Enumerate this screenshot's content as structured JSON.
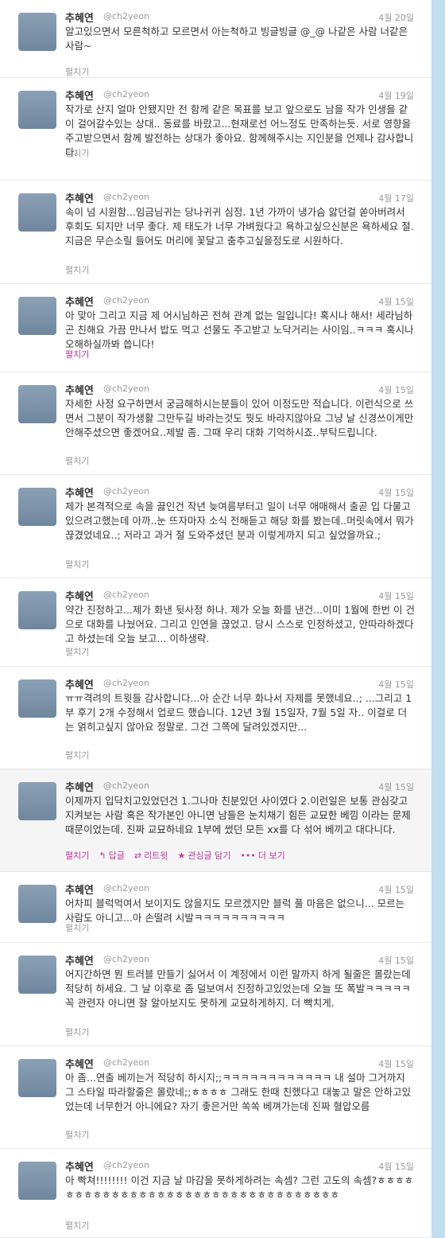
{
  "user": {
    "name": "추혜연",
    "handle": "@ch2yeon"
  },
  "expand_label": "펼치기",
  "actions": [
    {
      "icon": "reply-icon",
      "glyph": "↰",
      "label": "답글"
    },
    {
      "icon": "retweet-icon",
      "glyph": "⇄",
      "label": "리트윗"
    },
    {
      "icon": "favorite-star-icon",
      "glyph": "★",
      "label": "관심글 담기"
    },
    {
      "icon": "more-dots-icon",
      "glyph": "•••",
      "label": "더 보기"
    }
  ],
  "tweets": [
    {
      "date": "4월 20일",
      "text": "알고있으면서 모른척하고 모르면서 아는척하고 빙글빙글 @_@ 나같은 사람 너같은사람~"
    },
    {
      "date": "4월 19일",
      "text": "작가로 산지 얼마 안됐지만 전 함께 같은 목표를 보고 앞으로도 남을 작가 인생을 같이 걸어갈수있는 상대.. 동료를 바랐고...현재로선 어느정도 만족하는듯. 서로 영향을 주고받으면서 함께 발전하는 상대가 좋아요. 함께해주시는 지인분을 언제나 감사합니다."
    },
    {
      "date": "4월 17일",
      "text": "속이 넘 시원함...임금님귀는 당나귀귀 심정. 1년 가까이 냉가슴 앓던걸 쏟아버려서 후회도 되지만 너무 좋다. 제 태도가 너무 가벼웠다고 욕하고싶으신분은 욕하세요 절. 지금은 무슨소릴 들어도 머리에 꽃달고 춤추고싶을정도로 시원하다."
    },
    {
      "date": "4월 15일",
      "text": "아 맞아 그리고 지금 제 어시님하곤 전혀 관계 없는 일입니다! 혹시나 해서! 세라님하곤 친해요 가끔 만나서 밥도 먹고 선물도 주고받고 노닥거리는 사이임..ㅋㅋㅋ 혹시나 오해하실까봐 씁니다!"
    },
    {
      "date": "4월 15일",
      "text": "자세한 사정 요구하면서 궁금해하시는분들이 있어 이정도만 적습니다. 이런식으로 쓰면서 그분이 작가생활 그만두길 바라는것도 뭣도 바라지않아요 그냥 날 신경쓰이게만 안해주셨으면 좋겠어요..제발 좀. 그때 우리 대화 기억하시죠..부탁드립니다."
    },
    {
      "date": "4월 15일",
      "text": "제가 본격적으로 속을 끓인건 작년 늦여름부터고 일이 너무 애매해서 출곧 입 다물고있으려고했는데 아까..눈 뜨자마자 소식 전해듣고 해당 화를 봤는데..머릿속에서 뭐가 끊겼었네요..; 저라고 과거 절 도와주셨던 분과 이렇게까지 되고 싶었을까요.;"
    },
    {
      "date": "4월 15일",
      "text": "약간 진정하고...제가 화낸 뒷사정 하나. 제가 오늘 화를 낸건...이미 1월에 한번 이 건으로 대화를 나눴어요. 그리고 인연을 끊었고. 당시 스스로 인정하셨고, 안따라하겠다고 하셨는데 오늘 보고... 이하생략."
    },
    {
      "date": "4월 15일",
      "text": "ㅠㅠ격려의 트윗들 감사합니다...아 순간 너무 화나서 자제를 못했네요..; ...그리고 1부 후기 2개 수정해서 업로드 했습니다. 12년 3월 15일자, 7월 5일 자.. 이걸로 더는 얽히고싶지 않아요 정말로. 그건 그쪽에 달려있겠지만..."
    },
    {
      "date": "4월 15일",
      "text": "이제까지 입닥치고있었던건 1.그나마 친분있던 사이였다 2.이런일은 보통 관심갖고 지켜보는 사람 혹은 작가본인 아니면 남들은 눈치채기 힘든 교묘한 베낌 이라는 문제때문이었는데. 진짜 교묘하네요 1부에 썼던 모든 xx를 다 섞어 베끼고 대다니다."
    },
    {
      "date": "4월 15일",
      "text": "어차피 블럭먹여서 보이지도 않을지도 모르겠지만 블럭 풀 마음은 없으니... 모르는 사람도 아니고...아 손떨려 시발ㅋㅋㅋㅋㅋㅋㅋㅋㅋㅋ"
    },
    {
      "date": "4월 15일",
      "text": "어지간하면 뭔 트러블 만들기 싫어서 이 계정에서 이런 말까지 하게 될줄은 몰랐는데 적당히 하세요. 그 날 이후로 좀 덜보여서 진정하고있었는데 오늘 또 폭발ㅋㅋㅋㅋㅋ 꼭 관련자 아니면 잘 알아보지도 못하게 교묘하게하지. 더 빡치게."
    },
    {
      "date": "4월 15일",
      "text": "아 좀...연출 베끼는거 적당히 하시지;;ㅋㅋㅋㅋㅋㅋㅋㅋㅋㅋㅋㅋ 내 설마 그거까지 그 스타일 따라할줄은 몰랐네;;ㅎㅎㅎㅎ 그래도 한때 친했다고 대놓고 말은 안하고있었는데 너무한거 아니에요? 자기 좋은거만 쏙쏙 베껴가는데 진짜 혈압오름"
    },
    {
      "date": "4월 15일",
      "text": "아 빡쳐!!!!!!!! 이건 지금 날 마감을 못하게하려는 속셈? 그런 고도의 속셈?ㅎㅎㅎㅎㅎㅎㅎㅎㅎㅎㅎㅎㅎㅎㅎㅎㅎㅎㅎㅎㅎㅎㅎㅎㅎㅎㅎㅎㅎㅎㅎㅎㅎㅎ"
    }
  ]
}
